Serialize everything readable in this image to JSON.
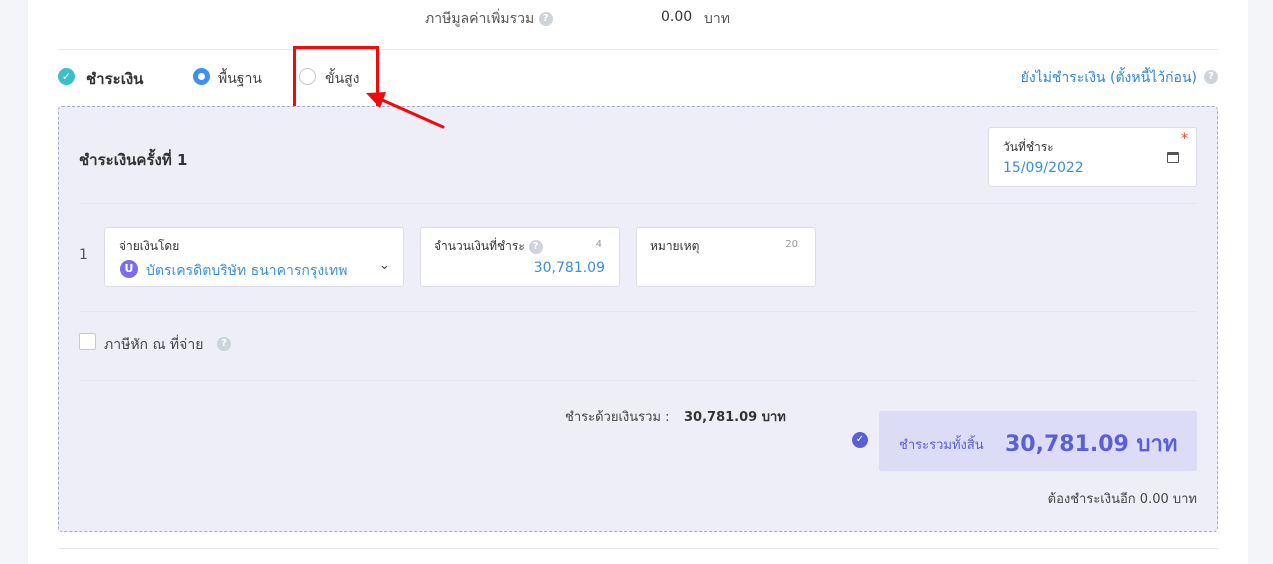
{
  "summary": {
    "vat_total_label": "ภาษีมูลค่าเพิ่มรวม",
    "vat_total_value": "0.00",
    "vat_total_unit": "บาท"
  },
  "payment": {
    "title": "ชำระเงิน",
    "mode_basic_label": "พื้นฐาน",
    "mode_advanced_label": "ขั้นสูง",
    "selected_mode": "พื้นฐาน",
    "unpaid_link": "ยังไม่ชำระเงิน (ตั้งหนี้ไว้ก่อน)"
  },
  "installment": {
    "title": "ชำระเงินครั้งที่ 1",
    "date_label": "วันที่ชำระ",
    "date_required_mark": "*",
    "date_value": "15/09/2022",
    "row_number": "1",
    "method_label": "จ่ายเงินโดย",
    "method_badge": "U",
    "method_value": "บัตรเครดิตบริษัท ธนาคารกรุงเทพ",
    "amount_label": "จำนวนเงินที่ชำระ",
    "amount_counter": "4",
    "amount_value": "30,781.09",
    "note_label": "หมายเหตุ",
    "note_counter": "20",
    "withholding_label": "ภาษีหัก ณ ที่จ่าย",
    "cash_total_label": "ชำระด้วยเงินรวม :",
    "cash_total_value": "30,781.09 บาท",
    "grand_total_label": "ชำระรวมทั้งสิ้น",
    "grand_total_value": "30,781.09 บาท",
    "remaining_label": "ต้องชำระเงินอีก 0.00 บาท"
  },
  "colors": {
    "accent": "#3e8ff0",
    "link": "#2f86d6",
    "teal": "#3cc0c8",
    "purple": "#5b5fd6",
    "highlight_red": "#f00a0a",
    "panel_bg": "#eeeef9"
  },
  "icons": {
    "help": "question-circle-icon",
    "calendar": "calendar-icon",
    "dropdown": "chevron-down-icon",
    "check": "check-circle-icon"
  }
}
